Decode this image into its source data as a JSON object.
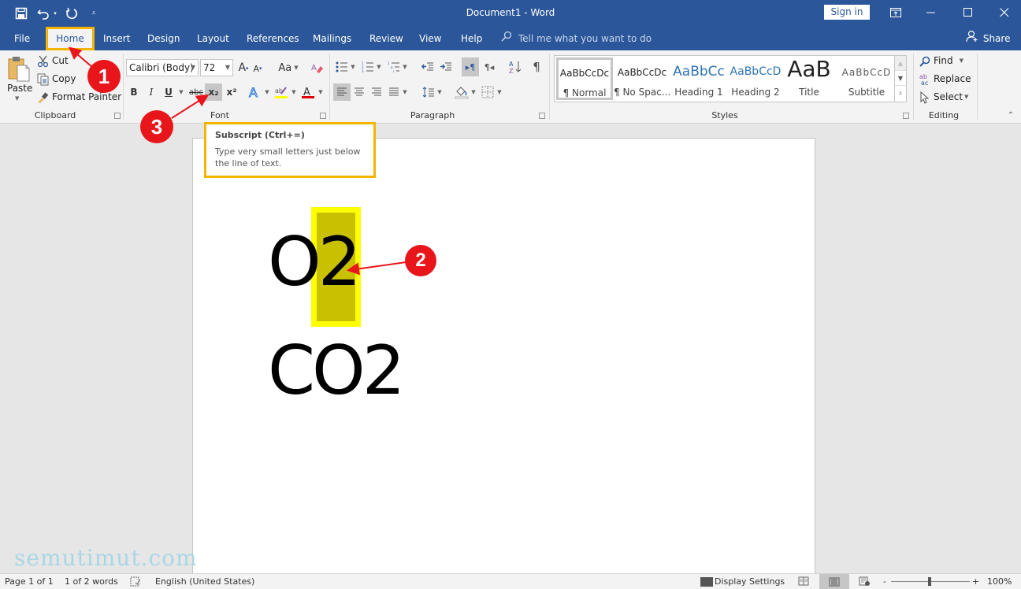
{
  "titlebar": {
    "title": "Document1  -  Word",
    "sign_in": "Sign in",
    "qat": [
      "save-icon",
      "undo-icon",
      "redo-icon",
      "customize-qat-icon"
    ],
    "window_controls": [
      "ribbon-display-options-icon",
      "minimize-icon",
      "maximize-icon",
      "close-icon"
    ]
  },
  "tabs": [
    {
      "label": "File"
    },
    {
      "label": "Home",
      "active": true
    },
    {
      "label": "Insert"
    },
    {
      "label": "Design"
    },
    {
      "label": "Layout"
    },
    {
      "label": "References"
    },
    {
      "label": "Mailings"
    },
    {
      "label": "Review"
    },
    {
      "label": "View"
    },
    {
      "label": "Help"
    }
  ],
  "tell_me": {
    "placeholder": "Tell me what you want to do"
  },
  "share": "Share",
  "ribbon": {
    "clipboard": {
      "label": "Clipboard",
      "paste": "Paste",
      "cut": "Cut",
      "copy": "Copy",
      "format_painter": "Format Painter"
    },
    "font": {
      "label": "Font",
      "font_name": "Calibri (Body)",
      "font_size": "72",
      "case": "Aa",
      "bold": "B",
      "italic": "I",
      "underline": "U",
      "strike": "abc",
      "subscript": "x₂",
      "superscript": "x²",
      "highlight_color": "#ffff00",
      "font_color": "#e00000"
    },
    "paragraph": {
      "label": "Paragraph"
    },
    "styles": {
      "label": "Styles",
      "items": [
        {
          "preview": "AaBbCcDc",
          "name": "¶ Normal",
          "selected": true,
          "color": "#000000"
        },
        {
          "preview": "AaBbCcDc",
          "name": "¶ No Spac...",
          "color": "#000000"
        },
        {
          "preview": "AaBbCc",
          "name": "Heading 1",
          "color": "#2e74b5"
        },
        {
          "preview": "AaBbCcD",
          "name": "Heading 2",
          "color": "#2e74b5"
        },
        {
          "preview": "AaB",
          "name": "Title",
          "color": "#000000"
        },
        {
          "preview": "AaBbCcD",
          "name": "Subtitle",
          "color": "#5a5a5a"
        }
      ]
    },
    "editing": {
      "label": "Editing",
      "find": "Find",
      "replace": "Replace",
      "select": "Select"
    }
  },
  "tooltip": {
    "title": "Subscript (Ctrl+=)",
    "body": "Type very small letters just below the line of text."
  },
  "document": {
    "line1_prefix": "O",
    "line1_selected": "2",
    "line2": "CO2"
  },
  "callouts": [
    "1",
    "2",
    "3"
  ],
  "statusbar": {
    "page": "Page 1 of 1",
    "words": "1 of 2 words",
    "language": "English (United States)",
    "display_settings": "Display Settings",
    "zoom": "100%",
    "zoom_minus": "-",
    "zoom_plus": "+"
  },
  "watermark": "semutimut.com",
  "colors": {
    "brand": "#2b579a",
    "callout": "#e8151b",
    "highlight_outline": "#f5b400",
    "selection_border": "#ffff00",
    "selection_fill": "#c8c000"
  }
}
